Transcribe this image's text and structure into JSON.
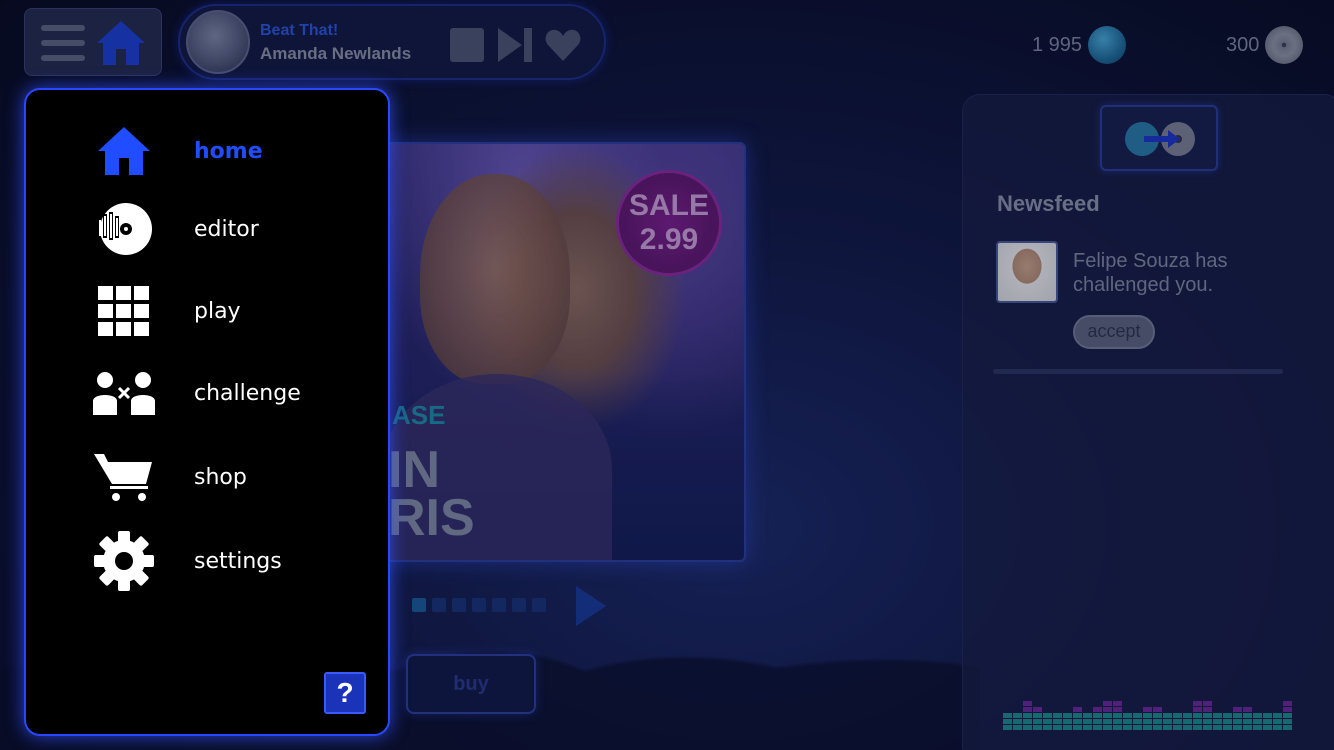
{
  "player": {
    "track_title": "Beat That!",
    "track_artist": "Amanda Newlands"
  },
  "currency": {
    "notes": "1 995",
    "discs": "300"
  },
  "album": {
    "sale_label": "SALE",
    "sale_price": "2.99",
    "release_partial": "ASE",
    "artist_line1": "IN",
    "artist_line2": "RIS",
    "buy_label": "buy"
  },
  "newsfeed": {
    "title": "Newsfeed",
    "message": "Felipe Souza has challenged you.",
    "accept_label": "accept"
  },
  "menu": {
    "items": [
      {
        "label": "home",
        "icon": "home-icon",
        "active": true
      },
      {
        "label": "editor",
        "icon": "editor-disc-icon",
        "active": false
      },
      {
        "label": "play",
        "icon": "grid-icon",
        "active": false
      },
      {
        "label": "challenge",
        "icon": "versus-icon",
        "active": false
      },
      {
        "label": "shop",
        "icon": "cart-icon",
        "active": false
      },
      {
        "label": "settings",
        "icon": "gear-icon",
        "active": false
      }
    ],
    "help_label": "?"
  },
  "colors": {
    "accent": "#1f4dff",
    "background": "#0b1030",
    "sale": "#7a1f8e"
  }
}
